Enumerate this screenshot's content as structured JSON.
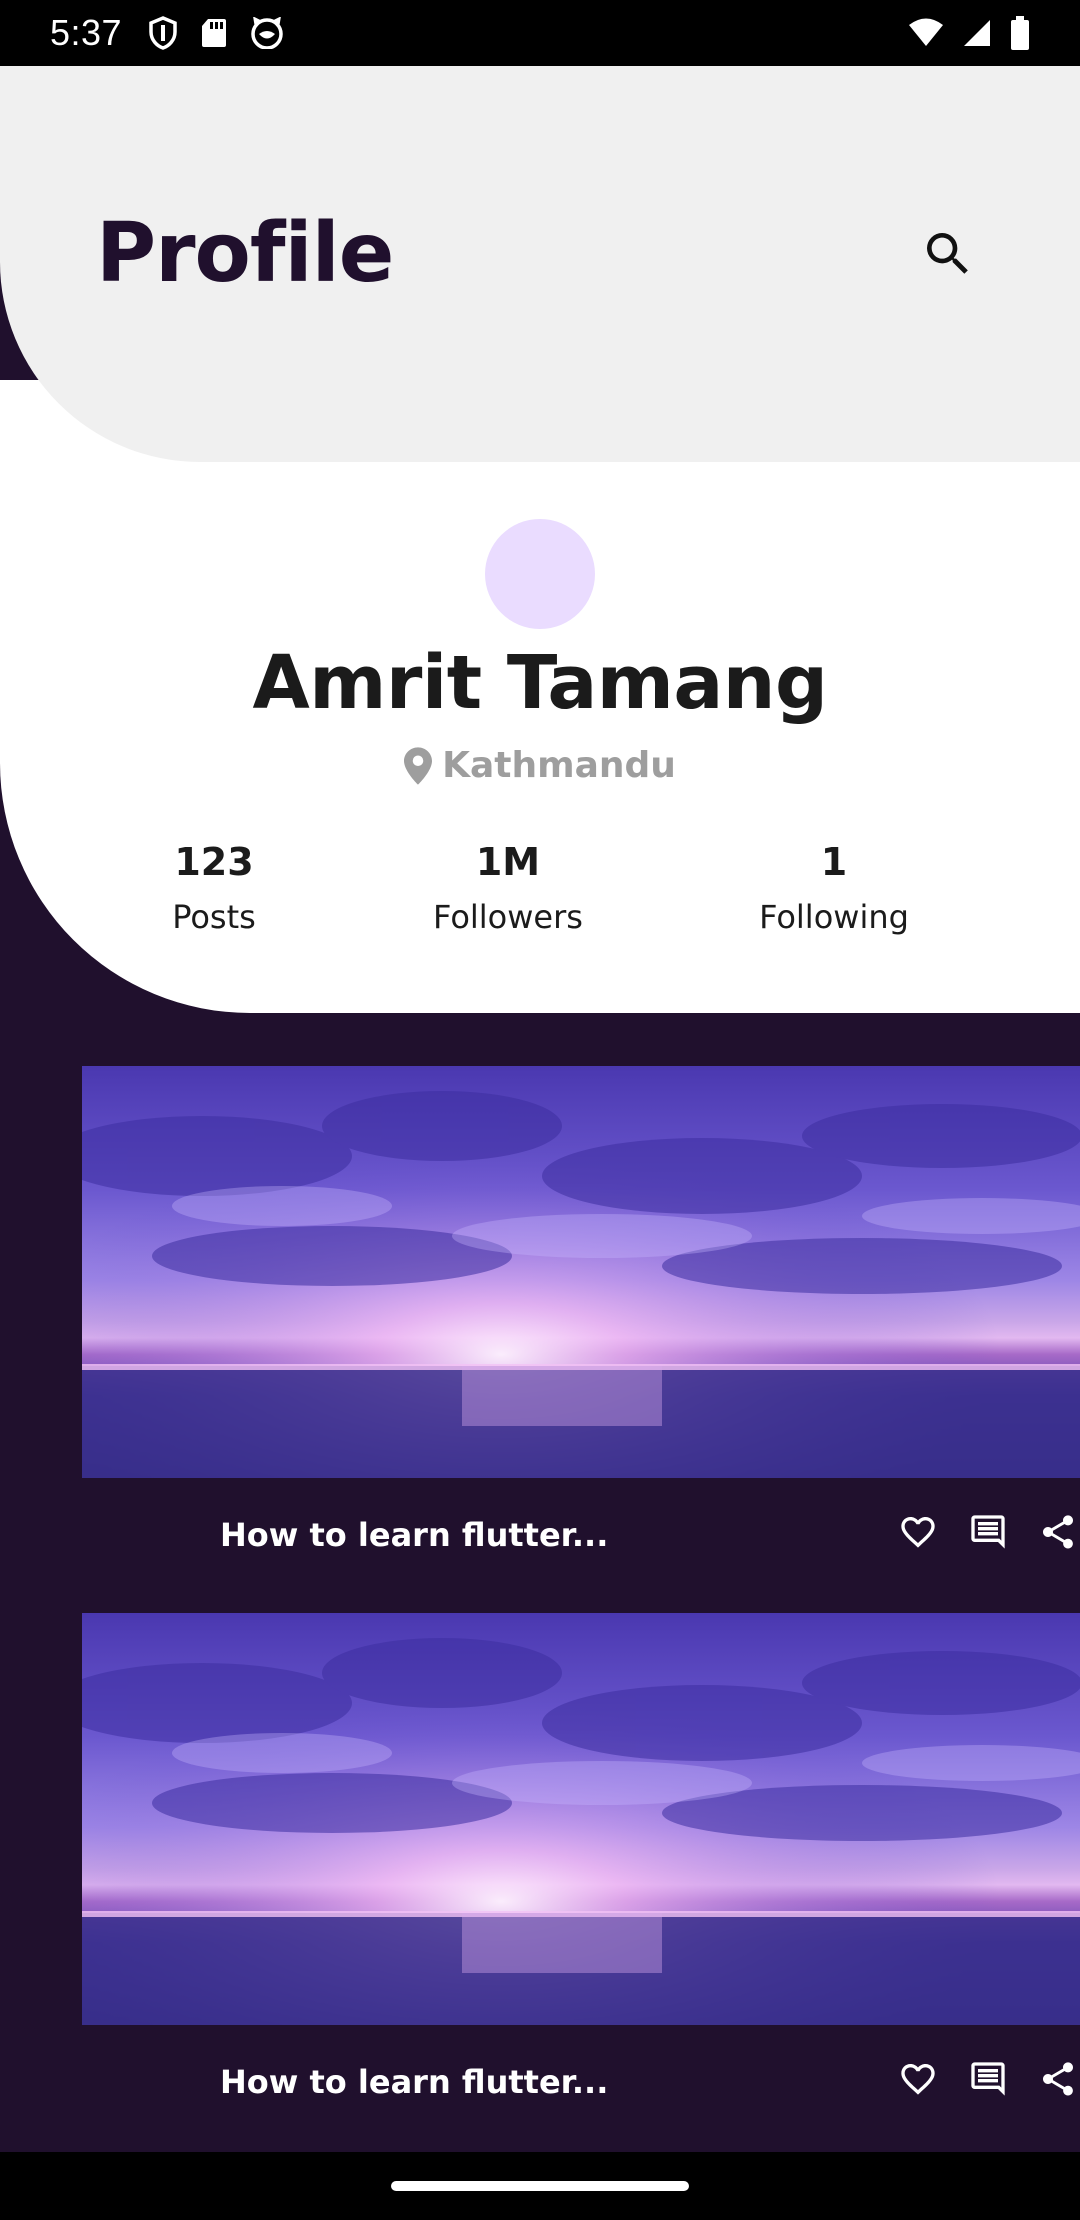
{
  "status_bar": {
    "time": "5:37",
    "left_icons": [
      "shield-icon",
      "sd-card-icon",
      "cat-face-icon"
    ],
    "right_icons": [
      "wifi-icon",
      "signal-icon",
      "battery-icon"
    ]
  },
  "header": {
    "title": "Profile",
    "search_icon": "search-icon"
  },
  "profile": {
    "name": "Amrit Tamang",
    "location": "Kathmandu",
    "avatar_color": "#eadcff",
    "stats": [
      {
        "value": "123",
        "label": "Posts"
      },
      {
        "value": "1M",
        "label": "Followers"
      },
      {
        "value": "1",
        "label": "Following"
      }
    ]
  },
  "posts": [
    {
      "title": "How to learn flutter...",
      "actions": [
        "heart-icon",
        "comment-icon",
        "share-icon"
      ]
    },
    {
      "title": "How to learn flutter...",
      "actions": [
        "heart-icon",
        "comment-icon",
        "share-icon"
      ]
    }
  ],
  "colors": {
    "background": "#20102d",
    "header_bg": "#f0f0f0",
    "card_bg": "#ffffff",
    "title_color": "#20102d",
    "location_color": "#9e9e9e"
  }
}
